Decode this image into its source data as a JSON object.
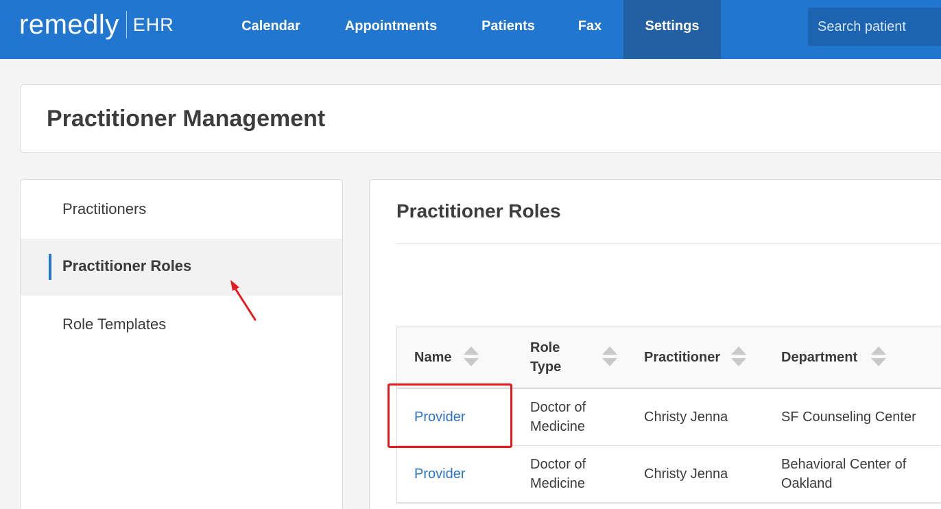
{
  "app": {
    "logo_word": "remedly",
    "logo_suffix": "EHR"
  },
  "nav": {
    "items": [
      {
        "label": "Calendar",
        "active": false
      },
      {
        "label": "Appointments",
        "active": false
      },
      {
        "label": "Patients",
        "active": false
      },
      {
        "label": "Fax",
        "active": false
      },
      {
        "label": "Settings",
        "active": true
      }
    ],
    "search_placeholder": "Search patient"
  },
  "header": {
    "title": "Practitioner Management"
  },
  "sidebar": {
    "items": [
      {
        "label": "Practitioners",
        "active": false
      },
      {
        "label": "Practitioner Roles",
        "active": true
      },
      {
        "label": "Role Templates",
        "active": false
      }
    ]
  },
  "main": {
    "title": "Practitioner Roles",
    "table": {
      "columns": [
        {
          "label": "Name"
        },
        {
          "label": "Role Type"
        },
        {
          "label": "Practitioner"
        },
        {
          "label": "Department"
        }
      ],
      "rows": [
        {
          "name": "Provider",
          "role_type": "Doctor of Medicine",
          "practitioner": "Christy Jenna",
          "department": "SF Counseling Center"
        },
        {
          "name": "Provider",
          "role_type": "Doctor of Medicine",
          "practitioner": "Christy Jenna",
          "department": "Behavioral Center of Oakland"
        }
      ]
    }
  },
  "colors": {
    "brand_blue": "#2177cf",
    "nav_active": "#225fa3",
    "link": "#2a73c4",
    "annotation_red": "#e8191d"
  }
}
